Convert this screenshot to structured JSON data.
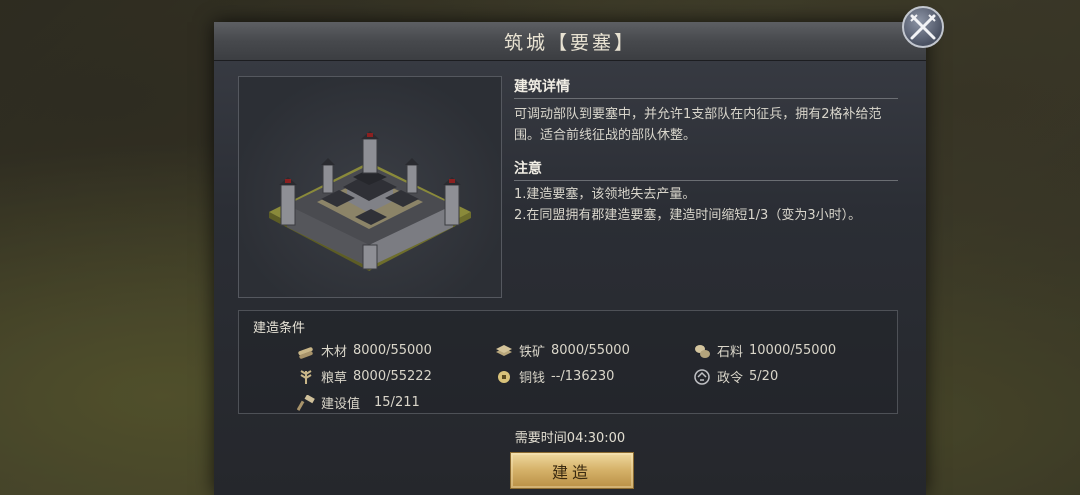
{
  "title": "筑城【要塞】",
  "details": {
    "heading": "建筑详情",
    "text": "可调动部队到要塞中，并允许1支部队在内征兵，拥有2格补给范围。适合前线征战的部队休整。"
  },
  "notes": {
    "heading": "注意",
    "line1": "1.建造要塞，该领地失去产量。",
    "line2": "2.在同盟拥有郡建造要塞，建造时间缩短1/3（变为3小时）。"
  },
  "conditions": {
    "heading": "建造条件",
    "items": [
      {
        "icon": "wood-icon",
        "label": "木材",
        "value": "8000/55000"
      },
      {
        "icon": "iron-ore-icon",
        "label": "铁矿",
        "value": "8000/55000"
      },
      {
        "icon": "stone-icon",
        "label": "石料",
        "value": "10000/55000"
      },
      {
        "icon": "grain-icon",
        "label": "粮草",
        "value": "8000/55222"
      },
      {
        "icon": "copper-coin-icon",
        "label": "铜钱",
        "value": "--/136230"
      },
      {
        "icon": "decree-icon",
        "label": "政令",
        "value": "5/20"
      },
      {
        "icon": "hammer-icon",
        "label": "建设值",
        "value": "15/211"
      }
    ]
  },
  "time_text": "需要时间04:30:00",
  "build_label": "建造"
}
